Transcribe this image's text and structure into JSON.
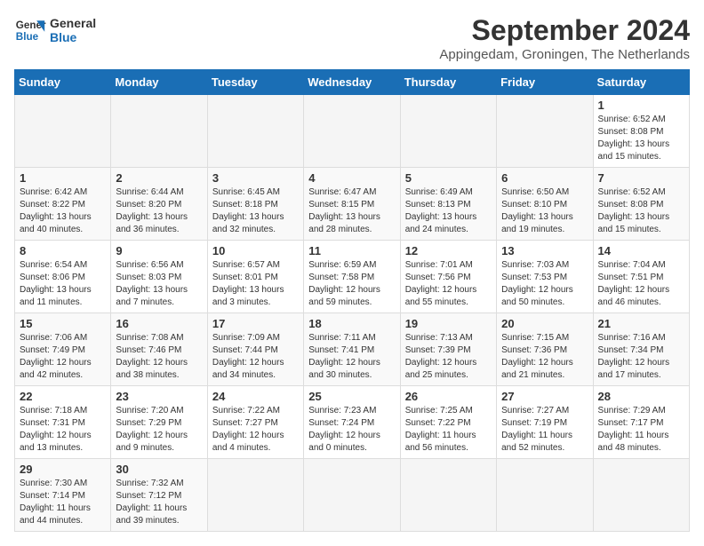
{
  "header": {
    "logo_line1": "General",
    "logo_line2": "Blue",
    "title": "September 2024",
    "subtitle": "Appingedam, Groningen, The Netherlands"
  },
  "calendar": {
    "headers": [
      "Sunday",
      "Monday",
      "Tuesday",
      "Wednesday",
      "Thursday",
      "Friday",
      "Saturday"
    ],
    "weeks": [
      [
        {
          "day": "",
          "empty": true
        },
        {
          "day": "",
          "empty": true
        },
        {
          "day": "",
          "empty": true
        },
        {
          "day": "",
          "empty": true
        },
        {
          "day": "",
          "empty": true
        },
        {
          "day": "",
          "empty": true
        },
        {
          "day": "1",
          "sunrise": "Sunrise: 6:52 AM",
          "sunset": "Sunset: 8:08 PM",
          "daylight": "Daylight: 13 hours and 15 minutes."
        }
      ],
      [
        {
          "day": "1",
          "sunrise": "Sunrise: 6:42 AM",
          "sunset": "Sunset: 8:22 PM",
          "daylight": "Daylight: 13 hours and 40 minutes."
        },
        {
          "day": "2",
          "sunrise": "Sunrise: 6:44 AM",
          "sunset": "Sunset: 8:20 PM",
          "daylight": "Daylight: 13 hours and 36 minutes."
        },
        {
          "day": "3",
          "sunrise": "Sunrise: 6:45 AM",
          "sunset": "Sunset: 8:18 PM",
          "daylight": "Daylight: 13 hours and 32 minutes."
        },
        {
          "day": "4",
          "sunrise": "Sunrise: 6:47 AM",
          "sunset": "Sunset: 8:15 PM",
          "daylight": "Daylight: 13 hours and 28 minutes."
        },
        {
          "day": "5",
          "sunrise": "Sunrise: 6:49 AM",
          "sunset": "Sunset: 8:13 PM",
          "daylight": "Daylight: 13 hours and 24 minutes."
        },
        {
          "day": "6",
          "sunrise": "Sunrise: 6:50 AM",
          "sunset": "Sunset: 8:10 PM",
          "daylight": "Daylight: 13 hours and 19 minutes."
        },
        {
          "day": "7",
          "sunrise": "Sunrise: 6:52 AM",
          "sunset": "Sunset: 8:08 PM",
          "daylight": "Daylight: 13 hours and 15 minutes."
        }
      ],
      [
        {
          "day": "8",
          "sunrise": "Sunrise: 6:54 AM",
          "sunset": "Sunset: 8:06 PM",
          "daylight": "Daylight: 13 hours and 11 minutes."
        },
        {
          "day": "9",
          "sunrise": "Sunrise: 6:56 AM",
          "sunset": "Sunset: 8:03 PM",
          "daylight": "Daylight: 13 hours and 7 minutes."
        },
        {
          "day": "10",
          "sunrise": "Sunrise: 6:57 AM",
          "sunset": "Sunset: 8:01 PM",
          "daylight": "Daylight: 13 hours and 3 minutes."
        },
        {
          "day": "11",
          "sunrise": "Sunrise: 6:59 AM",
          "sunset": "Sunset: 7:58 PM",
          "daylight": "Daylight: 12 hours and 59 minutes."
        },
        {
          "day": "12",
          "sunrise": "Sunrise: 7:01 AM",
          "sunset": "Sunset: 7:56 PM",
          "daylight": "Daylight: 12 hours and 55 minutes."
        },
        {
          "day": "13",
          "sunrise": "Sunrise: 7:03 AM",
          "sunset": "Sunset: 7:53 PM",
          "daylight": "Daylight: 12 hours and 50 minutes."
        },
        {
          "day": "14",
          "sunrise": "Sunrise: 7:04 AM",
          "sunset": "Sunset: 7:51 PM",
          "daylight": "Daylight: 12 hours and 46 minutes."
        }
      ],
      [
        {
          "day": "15",
          "sunrise": "Sunrise: 7:06 AM",
          "sunset": "Sunset: 7:49 PM",
          "daylight": "Daylight: 12 hours and 42 minutes."
        },
        {
          "day": "16",
          "sunrise": "Sunrise: 7:08 AM",
          "sunset": "Sunset: 7:46 PM",
          "daylight": "Daylight: 12 hours and 38 minutes."
        },
        {
          "day": "17",
          "sunrise": "Sunrise: 7:09 AM",
          "sunset": "Sunset: 7:44 PM",
          "daylight": "Daylight: 12 hours and 34 minutes."
        },
        {
          "day": "18",
          "sunrise": "Sunrise: 7:11 AM",
          "sunset": "Sunset: 7:41 PM",
          "daylight": "Daylight: 12 hours and 30 minutes."
        },
        {
          "day": "19",
          "sunrise": "Sunrise: 7:13 AM",
          "sunset": "Sunset: 7:39 PM",
          "daylight": "Daylight: 12 hours and 25 minutes."
        },
        {
          "day": "20",
          "sunrise": "Sunrise: 7:15 AM",
          "sunset": "Sunset: 7:36 PM",
          "daylight": "Daylight: 12 hours and 21 minutes."
        },
        {
          "day": "21",
          "sunrise": "Sunrise: 7:16 AM",
          "sunset": "Sunset: 7:34 PM",
          "daylight": "Daylight: 12 hours and 17 minutes."
        }
      ],
      [
        {
          "day": "22",
          "sunrise": "Sunrise: 7:18 AM",
          "sunset": "Sunset: 7:31 PM",
          "daylight": "Daylight: 12 hours and 13 minutes."
        },
        {
          "day": "23",
          "sunrise": "Sunrise: 7:20 AM",
          "sunset": "Sunset: 7:29 PM",
          "daylight": "Daylight: 12 hours and 9 minutes."
        },
        {
          "day": "24",
          "sunrise": "Sunrise: 7:22 AM",
          "sunset": "Sunset: 7:27 PM",
          "daylight": "Daylight: 12 hours and 4 minutes."
        },
        {
          "day": "25",
          "sunrise": "Sunrise: 7:23 AM",
          "sunset": "Sunset: 7:24 PM",
          "daylight": "Daylight: 12 hours and 0 minutes."
        },
        {
          "day": "26",
          "sunrise": "Sunrise: 7:25 AM",
          "sunset": "Sunset: 7:22 PM",
          "daylight": "Daylight: 11 hours and 56 minutes."
        },
        {
          "day": "27",
          "sunrise": "Sunrise: 7:27 AM",
          "sunset": "Sunset: 7:19 PM",
          "daylight": "Daylight: 11 hours and 52 minutes."
        },
        {
          "day": "28",
          "sunrise": "Sunrise: 7:29 AM",
          "sunset": "Sunset: 7:17 PM",
          "daylight": "Daylight: 11 hours and 48 minutes."
        }
      ],
      [
        {
          "day": "29",
          "sunrise": "Sunrise: 7:30 AM",
          "sunset": "Sunset: 7:14 PM",
          "daylight": "Daylight: 11 hours and 44 minutes."
        },
        {
          "day": "30",
          "sunrise": "Sunrise: 7:32 AM",
          "sunset": "Sunset: 7:12 PM",
          "daylight": "Daylight: 11 hours and 39 minutes."
        },
        {
          "day": "",
          "empty": true
        },
        {
          "day": "",
          "empty": true
        },
        {
          "day": "",
          "empty": true
        },
        {
          "day": "",
          "empty": true
        },
        {
          "day": "",
          "empty": true
        }
      ]
    ]
  }
}
